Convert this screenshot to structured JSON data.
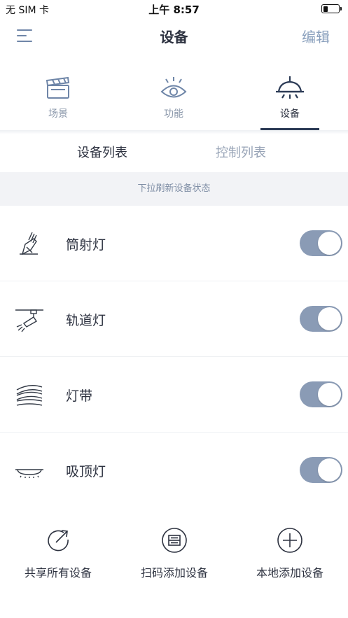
{
  "status_bar": {
    "carrier": "无 SIM 卡",
    "time": "上午 8:57"
  },
  "navbar": {
    "title": "设备",
    "edit_label": "编辑",
    "menu_icon": "hamburger-icon"
  },
  "main_tabs": [
    {
      "label": "场景",
      "icon": "clapperboard-icon",
      "active": false
    },
    {
      "label": "功能",
      "icon": "eye-icon",
      "active": false
    },
    {
      "label": "设备",
      "icon": "pendant-lamp-icon",
      "active": true
    }
  ],
  "sub_tabs": [
    {
      "label": "设备列表",
      "active": true
    },
    {
      "label": "控制列表",
      "active": false
    }
  ],
  "hint": "下拉刷新设备状态",
  "devices": [
    {
      "name": "筒射灯",
      "icon": "spotlight-icon",
      "on": true
    },
    {
      "name": "轨道灯",
      "icon": "track-light-icon",
      "on": true
    },
    {
      "name": "灯带",
      "icon": "light-strip-icon",
      "on": true
    },
    {
      "name": "吸顶灯",
      "icon": "ceiling-light-icon",
      "on": true
    }
  ],
  "actions": [
    {
      "label": "共享所有设备",
      "icon": "share-icon"
    },
    {
      "label": "扫码添加设备",
      "icon": "scan-icon"
    },
    {
      "label": "本地添加设备",
      "icon": "add-icon"
    }
  ],
  "colors": {
    "accent": "#2b3a55",
    "toggle_on": "#8a9bb5",
    "icon_blue": "#6f86a8",
    "hint_bg": "#f2f3f6"
  }
}
